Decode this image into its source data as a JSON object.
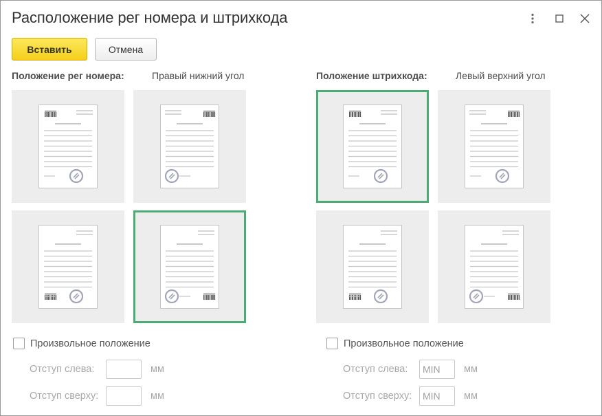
{
  "window": {
    "title": "Расположение рег номера и штрихкода",
    "controls": [
      "more-icon",
      "maximize-icon",
      "close-icon"
    ]
  },
  "toolbar": {
    "insert_label": "Вставить",
    "cancel_label": "Отмена"
  },
  "reg_number": {
    "label": "Положение рег номера:",
    "value": "Правый нижний угол",
    "selected_position": "bottom-right",
    "custom_position_label": "Произвольное положение",
    "custom_position_checked": false,
    "offset_left_label": "Отступ слева:",
    "offset_left_value": "",
    "offset_top_label": "Отступ сверху:",
    "offset_top_value": "",
    "unit": "мм"
  },
  "barcode": {
    "label": "Положение штрихкода:",
    "value": "Левый верхний угол",
    "selected_position": "top-left",
    "custom_position_label": "Произвольное положение",
    "custom_position_checked": false,
    "offset_left_label": "Отступ слева:",
    "offset_left_value": "MIN",
    "offset_top_label": "Отступ сверху:",
    "offset_top_value": "MIN",
    "unit": "мм"
  },
  "colors": {
    "selected_border": "#4caa74",
    "primary_button": "#f5cf1a",
    "tile_background": "#ededed"
  }
}
